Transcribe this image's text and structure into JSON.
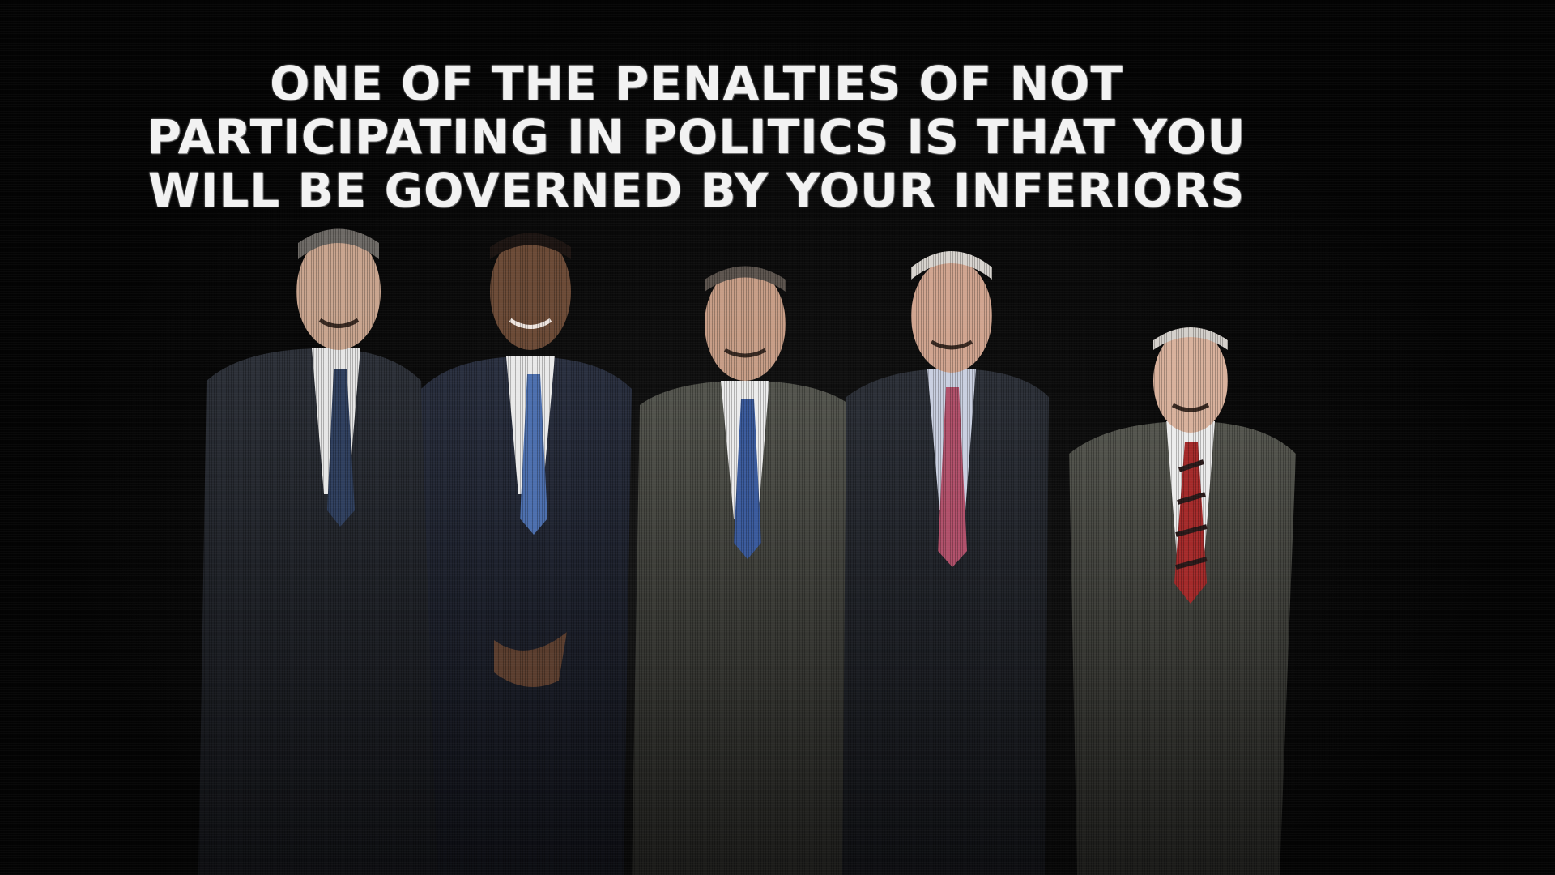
{
  "quote": {
    "text": "ONE OF THE PENALTIES OF NOT PARTICIPATING IN POLITICS IS THAT YOU WILL BE GOVERNED BY YOUR INFERIORS"
  },
  "colors": {
    "background": "#050505",
    "text": "#f2f2f2",
    "suit_dark": "#23262d",
    "suit_grey": "#4a4b48",
    "shirt": "#e9e9e9",
    "tie_blue": "#3f5f9e",
    "tie_pink": "#b0506a",
    "tie_red": "#a42a2a",
    "skin": "#c9a28a"
  }
}
